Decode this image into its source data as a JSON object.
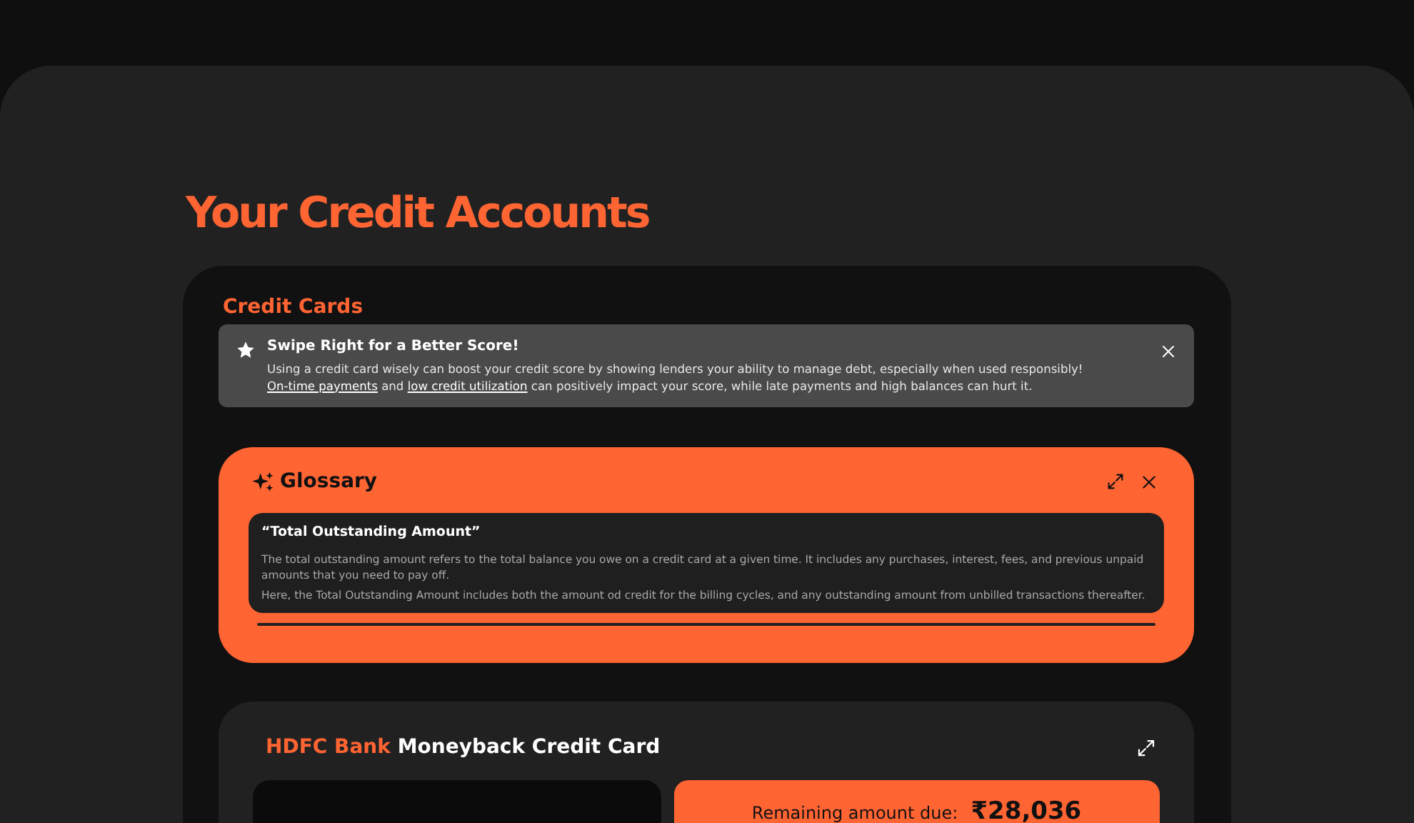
{
  "page_title": "Your Credit Accounts",
  "section": {
    "title": "Credit Cards"
  },
  "tip": {
    "title": "Swipe Right for a Better Score!",
    "body": [
      {
        "kind": "text",
        "text": "Using a credit card wisely can boost your credit score by showing lenders your ability to manage debt, especially when used responsibly! "
      },
      {
        "kind": "link",
        "text": "On-time payments"
      },
      {
        "kind": "text",
        "text": " and "
      },
      {
        "kind": "link",
        "text": "low credit utilization"
      },
      {
        "kind": "text",
        "text": " can positively impact your score, while late payments and high balances can hurt it."
      }
    ]
  },
  "glossary": {
    "title": "Glossary",
    "term": "“Total Outstanding Amount”",
    "paragraphs": [
      "The total outstanding amount refers to the total balance you owe on a credit card at a given time. It includes any purchases, interest, fees, and previous unpaid amounts that you need to pay off.",
      "Here, the Total Outstanding Amount includes both the amount od credit for the billing cycles, and any outstanding amount from unbilled transactions thereafter."
    ]
  },
  "card": {
    "bank": "HDFC Bank",
    "name": "Moneyback Credit Card",
    "due_label": "Remaining amount due:",
    "due_amount": "₹28,036"
  }
}
